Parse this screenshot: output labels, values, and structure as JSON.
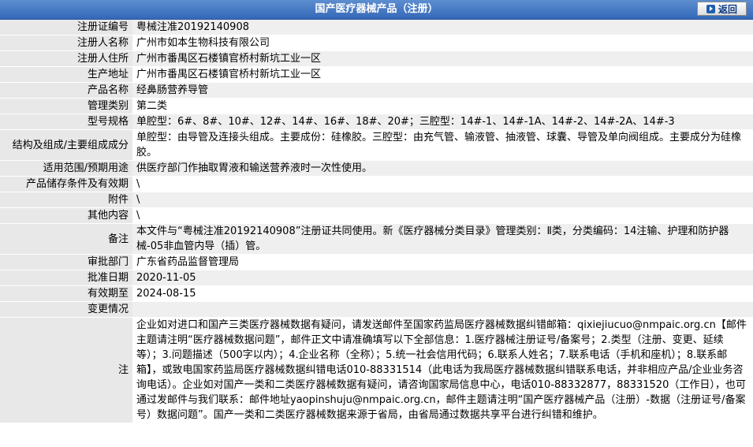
{
  "header": {
    "title": "国产医疗器械产品（注册）",
    "back_label": "返回"
  },
  "rows": [
    {
      "label": "注册证编号",
      "value": "粤械注准20192140908"
    },
    {
      "label": "注册人名称",
      "value": "广州市如本生物科技有限公司"
    },
    {
      "label": "注册人住所",
      "value": "广州市番禺区石楼镇官桥村新坑工业一区"
    },
    {
      "label": "生产地址",
      "value": "广州市番禺区石楼镇官桥村新坑工业一区"
    },
    {
      "label": "产品名称",
      "value": "经鼻肠营养导管"
    },
    {
      "label": "管理类别",
      "value": "第二类"
    },
    {
      "label": "型号规格",
      "value": "单腔型：6#、8#、10#、12#、14#、16#、18#、20#；三腔型：14#-1、14#-1A、14#-2、14#-2A、14#-3"
    },
    {
      "label": "结构及组成/主要组成成分",
      "value": "单腔型：由导管及连接头组成。主要成份：硅橡胶。三腔型：由充气管、输液管、抽液管、球囊、导管及单向阀组成。主要成分为硅橡胶。"
    },
    {
      "label": "适用范围/预期用途",
      "value": "供医疗部门作抽取胃液和输送营养液时一次性使用。"
    },
    {
      "label": "产品储存条件及有效期",
      "value": "\\"
    },
    {
      "label": "附件",
      "value": "\\"
    },
    {
      "label": "其他内容",
      "value": "\\"
    },
    {
      "label": "备注",
      "value": "本文件与“粤械注准20192140908”注册证共同使用。新《医疗器械分类目录》管理类别：Ⅱ类，分类编码：14注输、护理和防护器械-05非血管内导（插）管。"
    },
    {
      "label": "审批部门",
      "value": "广东省药品监督管理局"
    },
    {
      "label": "批准日期",
      "value": "2020-11-05"
    },
    {
      "label": "有效期至",
      "value": "2024-08-15"
    },
    {
      "label": "变更情况",
      "value": ""
    },
    {
      "label": "注",
      "value": "企业如对进口和国产三类医疗器械数据有疑问，请发送邮件至国家药监局医疗器械数据纠错邮箱：qixiejiucuo@nmpaic.org.cn【邮件主题请注明“医疗器械数据问题”，邮件正文中请准确填写以下全部信息：1.医疗器械注册证号/备案号；2.类型（注册、变更、延续等）；3.问题描述（500字以内）；4.企业名称（全称）；5.统一社会信用代码；6.联系人姓名；7.联系电话（手机和座机）；8.联系邮箱】，或致电国家药监局医疗器械数据纠错电话010-88331514（此电话为我局医疗器械数据纠错联系电话，并非相应产品/企业业务咨询电话）。企业如对国产一类和二类医疗器械数据有疑问，请咨询国家局信息中心，电话010-88332877，88331520（工作日），也可通过发邮件与我们联系：邮件地址yaopinshuju@nmpaic.org.cn，邮件主题请注明“国产医疗器械产品（注册）-数据（注册证号/备案号）数据问题”。国产一类和二类医疗器械数据来源于省局，由省局通过数据共享平台进行纠错和维护。"
    }
  ]
}
